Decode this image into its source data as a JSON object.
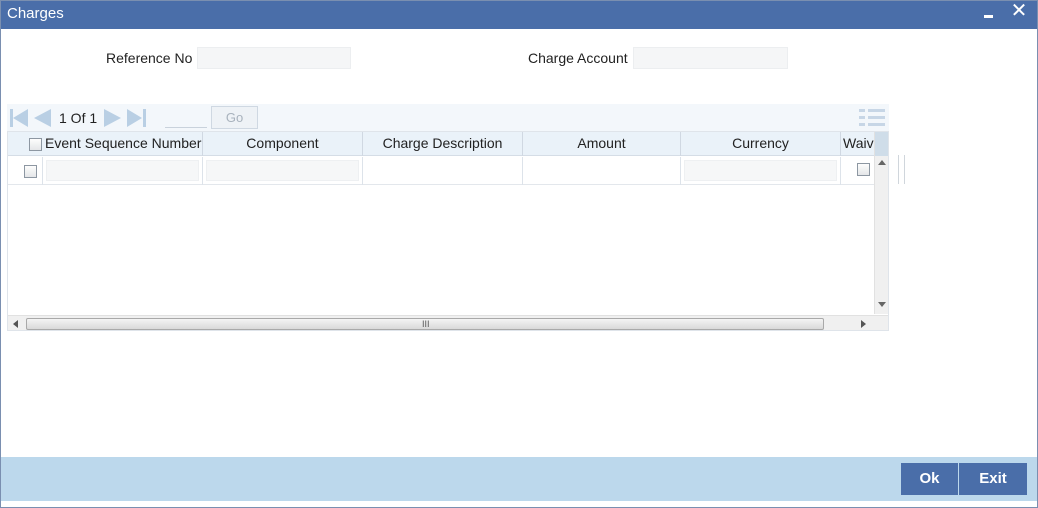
{
  "window": {
    "title": "Charges",
    "close_glyph": "✕"
  },
  "form": {
    "reference_no_label": "Reference No",
    "reference_no_value": "",
    "charge_account_label": "Charge Account",
    "charge_account_value": ""
  },
  "navigation": {
    "page_info": "1 Of 1",
    "page_input": "",
    "go_label": "Go"
  },
  "grid": {
    "columns": [
      "Event Sequence Number",
      "Component",
      "Charge Description",
      "Amount",
      "Currency",
      "Waiv"
    ],
    "rows": [
      {
        "event_sequence_number": "",
        "component": "",
        "charge_description": "",
        "amount": "",
        "currency": "",
        "waived": false
      }
    ]
  },
  "scrollbar": {
    "grip": "III"
  },
  "footer": {
    "ok_label": "Ok",
    "exit_label": "Exit"
  },
  "colors": {
    "titlebar": "#4a6ea9",
    "footer": "#bcd8ec",
    "button": "#4a6ea9",
    "grid_header": "#eaf2f9"
  },
  "icons": [
    "minimize-icon",
    "close-icon",
    "first-page-icon",
    "previous-page-icon",
    "next-page-icon",
    "last-page-icon",
    "list-view-icon"
  ]
}
